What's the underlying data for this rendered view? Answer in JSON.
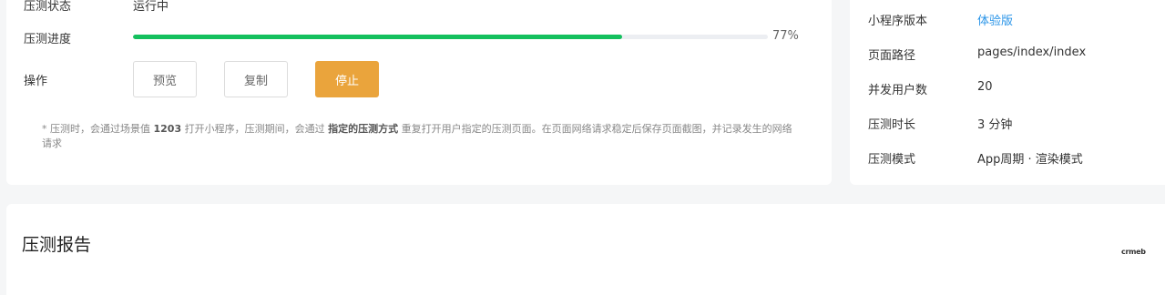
{
  "task": {
    "status_label": "压测状态",
    "status_value": "运行中",
    "progress_label": "压测进度",
    "progress": 0.77,
    "progress_text": "77%",
    "action_label": "操作",
    "buttons": {
      "preview": "预览",
      "copy": "复制",
      "stop": "停止"
    },
    "note": {
      "part1": "* 压测时，会通过场景值 ",
      "scene": "1203",
      "part2": " 打开小程序，压测期间，会通过 ",
      "mode": "指定的压测方式",
      "part3": " 重复打开用户指定的压测页面。在页面网络请求稳定后保存页面截图，并记录发生的网络请求"
    }
  },
  "info": {
    "rows": [
      {
        "key": "小程序版本",
        "value": "体验版"
      },
      {
        "key": "页面路径",
        "value": "pages/index/index"
      },
      {
        "key": "并发用户数",
        "value": "20"
      },
      {
        "key": "压测时长",
        "value": "3 分钟"
      },
      {
        "key": "压测模式",
        "value": "App周期 · 渲染模式"
      }
    ]
  },
  "report": {
    "title": "压测报告"
  },
  "watermark": "crmeb",
  "colors": {
    "progress": "#14c05e",
    "stop_button": "#eaa43c",
    "link": "#2b95e8"
  }
}
